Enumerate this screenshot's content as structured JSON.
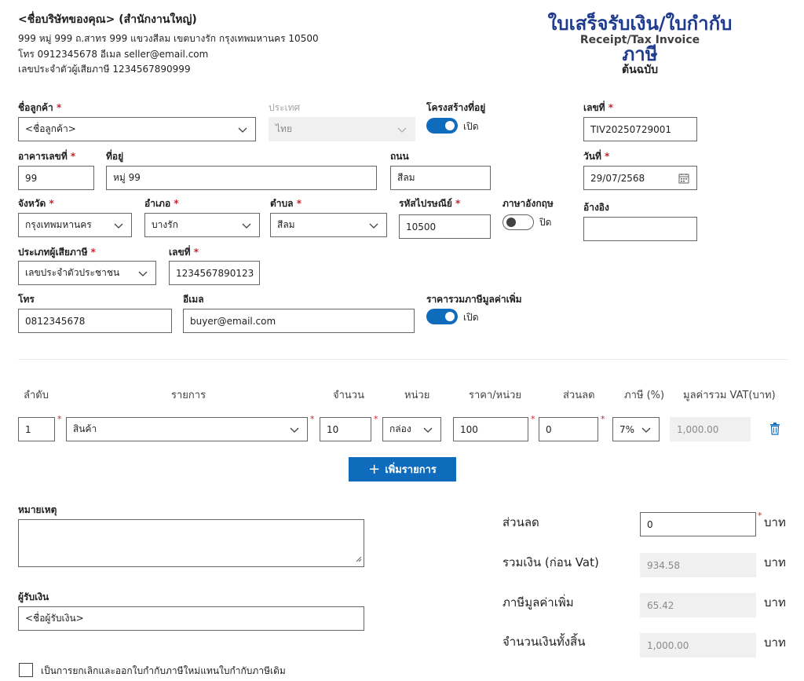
{
  "seller": {
    "name": "<ชื่อบริษัทของคุณ> (สำนักงานใหญ่)",
    "address": "999 หมู่ 999 ถ.สาทร 999 แขวงสีลม เขตบางรัก กรุงเทพมหานคร 10500",
    "contact": "โทร 0912345678 อีเมล seller@email.com",
    "tax_id": "เลขประจำตัวผู้เสียภาษี 1234567890999"
  },
  "doc": {
    "title": "ใบเสร็จรับเงิน/ใบกำกับภาษี",
    "subtitle": "Receipt/Tax Invoice",
    "copy": "ต้นฉบับ"
  },
  "form": {
    "customer_label": "ชื่อลูกค้า",
    "customer_value": "<ชื่อลูกค้า>",
    "country_label": "ประเทศ",
    "country_value": "ไทย",
    "structured_address_label": "โครงสร้างที่อยู่",
    "structured_address_state": "เปิด",
    "number_label": "เลขที่",
    "number_value": "TIV20250729001",
    "building_label": "อาคารเลขที่",
    "building_value": "99",
    "address_label": "ที่อยู่",
    "address_value": "หมู่ 99",
    "road_label": "ถนน",
    "road_value": "สีลม",
    "date_label": "วันที่",
    "date_value": "29/07/2568",
    "province_label": "จังหวัด",
    "province_value": "กรุงเทพมหานคร",
    "district_label": "อำเภอ",
    "district_value": "บางรัก",
    "subdistrict_label": "ตำบล",
    "subdistrict_value": "สีลม",
    "postcode_label": "รหัสไปรษณีย์",
    "postcode_value": "10500",
    "english_label": "ภาษาอังกฤษ",
    "english_state": "ปิด",
    "reference_label": "อ้างอิง",
    "reference_value": "",
    "taxpayer_type_label": "ประเภทผู้เสียภาษี",
    "taxpayer_type_value": "เลขประจำตัวประชาชน",
    "tax_number_label": "เลขที่",
    "tax_number_value": "1234567890123",
    "phone_label": "โทร",
    "phone_value": "0812345678",
    "email_label": "อีเมล",
    "email_value": "buyer@email.com",
    "vat_included_label": "ราคารวมภาษีมูลค่าเพิ่ม",
    "vat_included_state": "เปิด",
    "required_mark": "*"
  },
  "items": {
    "headers": [
      "ลำดับ",
      "รายการ",
      "จำนวน",
      "หน่วย",
      "ราคา/หน่วย",
      "ส่วนลด",
      "ภาษี (%)",
      "มูลค่ารวม VAT(บาท)"
    ],
    "rows": [
      {
        "seq": "1",
        "item": "สินค้า",
        "qty": "10",
        "unit": "กล่อง",
        "price": "100",
        "discount": "0",
        "tax": "7%",
        "total": "1,000.00"
      }
    ],
    "add_label": "เพิ่มรายการ"
  },
  "notes": {
    "label": "หมายเหตุ",
    "value": ""
  },
  "receiver": {
    "label": "ผู้รับเงิน",
    "value": "<ชื่อผู้รับเงิน>"
  },
  "cancel_checkbox_label": "เป็นการยกเลิกและออกใบกำกับภาษีใหม่แทนใบกำกับภาษีเดิม",
  "summary": {
    "unit": "บาท",
    "discount_label": "ส่วนลด",
    "discount_value": "0",
    "subtotal_label": "รวมเงิน (ก่อน Vat)",
    "subtotal_value": "934.58",
    "vat_label": "ภาษีมูลค่าเพิ่ม",
    "vat_value": "65.42",
    "grand_total_label": "จำนวนเงินทั้งสิ้น",
    "grand_total_value": "1,000.00"
  },
  "colors": {
    "accent": "#0f6cbd",
    "title": "#1f3b8c",
    "required": "#c4262e",
    "readonly_bg": "#f0f0f0"
  }
}
